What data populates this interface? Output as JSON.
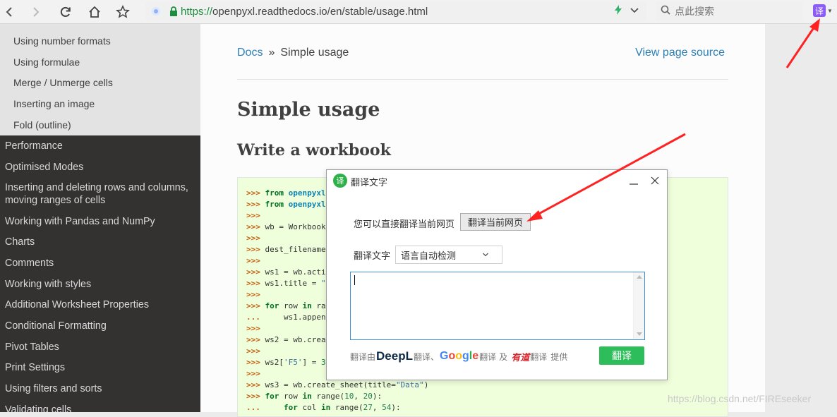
{
  "browser": {
    "url_scheme": "https://",
    "url_host": "openpyxl.readthedocs.io",
    "url_path": "/en/stable/usage.html",
    "search_placeholder": "点此搜索",
    "extension_badge": "译",
    "icons": [
      "back-icon",
      "forward-icon",
      "reload-icon",
      "home-icon",
      "star-icon",
      "lock-icon",
      "lightning-icon",
      "chevron-down-icon",
      "search-icon"
    ]
  },
  "sidebar": {
    "sub_items": [
      {
        "label": "Using number formats"
      },
      {
        "label": "Using formulae"
      },
      {
        "label": "Merge / Unmerge cells"
      },
      {
        "label": "Inserting an image"
      },
      {
        "label": "Fold (outline)"
      }
    ],
    "items": [
      {
        "label": "Performance"
      },
      {
        "label": "Optimised Modes"
      },
      {
        "label": "Inserting and deleting rows and columns, moving ranges of cells"
      },
      {
        "label": "Working with Pandas and NumPy"
      },
      {
        "label": "Charts"
      },
      {
        "label": "Comments"
      },
      {
        "label": "Working with styles"
      },
      {
        "label": "Additional Worksheet Properties"
      },
      {
        "label": "Conditional Formatting"
      },
      {
        "label": "Pivot Tables"
      },
      {
        "label": "Print Settings"
      },
      {
        "label": "Using filters and sorts"
      },
      {
        "label": "Validating cells"
      }
    ]
  },
  "content": {
    "breadcrumb_home": "Docs",
    "breadcrumb_sep": "»",
    "breadcrumb_current": "Simple usage",
    "view_source": "View page source",
    "title": "Simple usage",
    "section": "Write a workbook"
  },
  "dialog": {
    "title": "翻译文字",
    "logo": "译",
    "page_hint": "您可以直接翻译当前网页",
    "translate_page_button": "翻译当前网页",
    "translate_text_label": "翻译文字",
    "language_option": "语言自动检测",
    "textarea_value": "",
    "footer_prefix": "翻译由",
    "deepl": "DeepL",
    "footer_translate": "翻译、",
    "google_translate": "翻译",
    "and": "及",
    "youdao": "有道",
    "youdao_translate": "翻译",
    "footer_suffix": "提供",
    "translate_button": "翻译"
  },
  "watermark": "https://blog.csdn.net/FIREseeker"
}
